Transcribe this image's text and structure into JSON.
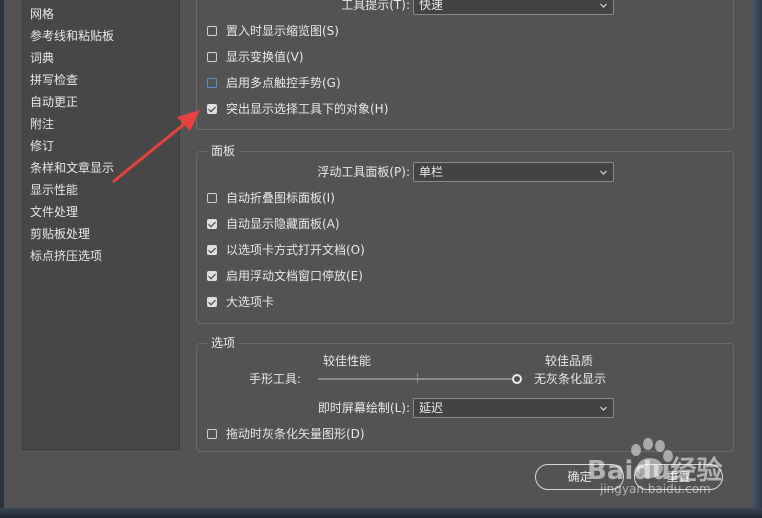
{
  "sidebar": {
    "items": [
      {
        "label": "网格"
      },
      {
        "label": "参考线和粘贴板"
      },
      {
        "label": "词典"
      },
      {
        "label": "拼写检查"
      },
      {
        "label": "自动更正"
      },
      {
        "label": "附注"
      },
      {
        "label": "修订"
      },
      {
        "label": "条样和文章显示"
      },
      {
        "label": "显示性能"
      },
      {
        "label": "文件处理"
      },
      {
        "label": "剪贴板处理"
      },
      {
        "label": "标点挤压选项"
      }
    ]
  },
  "tools_group": {
    "tooltip_label": "工具提示(T):",
    "tooltip_value": "快速",
    "options": [
      {
        "label": "置入时显示缩览图(S)",
        "checked": false
      },
      {
        "label": "显示变换值(V)",
        "checked": false
      },
      {
        "label": "启用多点触控手势(G)",
        "checked": false
      },
      {
        "label": "突出显示选择工具下的对象(H)",
        "checked": true
      }
    ]
  },
  "panels_group": {
    "title": "面板",
    "floating_label": "浮动工具面板(P):",
    "floating_value": "单栏",
    "options": [
      {
        "label": "自动折叠图标面板(I)",
        "checked": false
      },
      {
        "label": "自动显示隐藏面板(A)",
        "checked": true
      },
      {
        "label": "以选项卡方式打开文档(O)",
        "checked": true
      },
      {
        "label": "启用浮动文档窗口停放(E)",
        "checked": true
      },
      {
        "label": "大选项卡",
        "checked": true
      }
    ]
  },
  "options_group": {
    "title": "选项",
    "better_performance": "较佳性能",
    "better_quality": "较佳品质",
    "hand_tool_label": "手形工具:",
    "no_greek": "无灰条化显示",
    "slider_value": 1.0,
    "live_draw_label": "即时屏幕绘制(L):",
    "live_draw_value": "延迟",
    "greek_vector_label": "拖动时灰条化矢量图形(D)",
    "greek_vector_checked": false
  },
  "buttons": {
    "ok": "确定",
    "reset": "重置"
  },
  "watermark": {
    "logo_text": "Baidu经验",
    "url": "jingyan.baidu.com"
  },
  "colors": {
    "background": "#535353",
    "sidebar": "#474747",
    "annotation_arrow": "#e8423f",
    "checkbox_focus": "#5b8fd6"
  }
}
